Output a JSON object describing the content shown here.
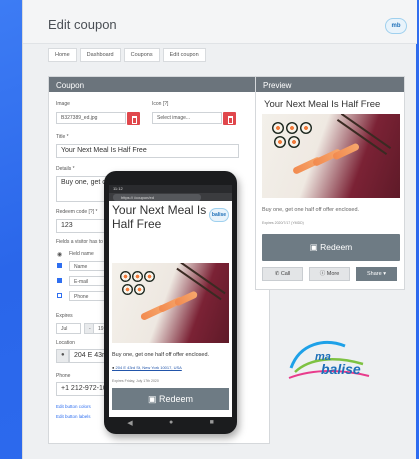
{
  "page_title": "Edit coupon",
  "brand_logo": "ma balise",
  "breadcrumbs": [
    "Home",
    "Dashboard",
    "Coupons",
    "Edit coupon"
  ],
  "coupon_panel": {
    "header": "Coupon",
    "image_label": "Image",
    "image_value": "B327389_ed.jpg",
    "icon_label": "Icon [?]",
    "icon_placeholder": "Select image...",
    "title_label": "Title *",
    "title_value": "Your Next Meal Is Half Free",
    "details_label": "Details *",
    "details_value": "Buy one, get o",
    "redeem_code_label": "Redeem code [?] *",
    "redeem_code_value": "123",
    "fields_label": "Fields a visitor has to",
    "field_name_header": "Field name",
    "fields": [
      "Name",
      "E-mail",
      "Phone"
    ],
    "expires_label": "Expires",
    "expires_month": "Jul",
    "expires_year": "19",
    "location_label": "Location",
    "location_value": "204 E 43r",
    "phone_label": "Phone",
    "phone_value": "+1 212-972-10",
    "edit_links": [
      "Edit button colors",
      "Edit button labels"
    ]
  },
  "preview_panel": {
    "header": "Preview",
    "title": "Your Next Meal Is Half Free",
    "details": "Buy one, get one half off offer enclosed.",
    "expires": "Expires 2020/7/17 (YMDD)",
    "redeem_label": "Redeem",
    "call_label": "Call",
    "more_label": "More",
    "share_label": "Share"
  },
  "phone_preview": {
    "status_time": "11:12",
    "url": "https://                    /coupon/ed",
    "title": "Your Next Meal Is Half Free",
    "details": "Buy one, get one half off offer enclosed.",
    "address": "204 E 43rd St, New York 10017, USA",
    "expires": "Expires Friday, July 17th 2020",
    "redeem_label": "Redeem",
    "logo_text": "balise"
  },
  "colors": {
    "background": "#2f6ff0",
    "panel_header": "#6b747c",
    "redeem_button": "#6e7b84",
    "delete_button": "#e0474c"
  }
}
